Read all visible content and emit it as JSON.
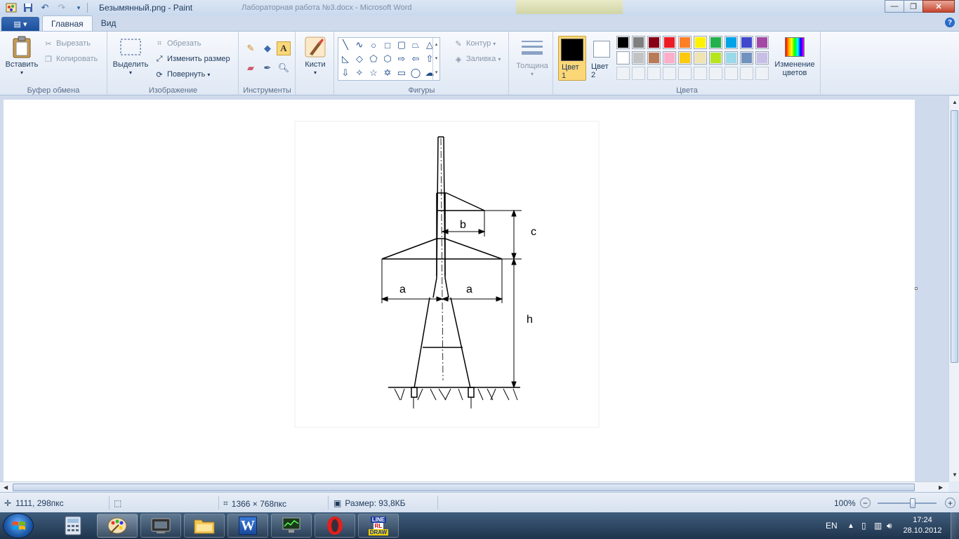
{
  "window": {
    "title": "Безымянный.png - Paint",
    "bg_title": "Лабораторная работа №3.docx - Microsoft Word"
  },
  "tabs": [
    {
      "label": "Главная",
      "active": true
    },
    {
      "label": "Вид",
      "active": false
    }
  ],
  "ribbon": {
    "clipboard": {
      "paste": "Вставить",
      "cut": "Вырезать",
      "copy": "Копировать",
      "label": "Буфер обмена"
    },
    "image": {
      "select": "Выделить",
      "crop": "Обрезать",
      "resize": "Изменить размер",
      "rotate": "Повернуть",
      "label": "Изображение"
    },
    "tools": {
      "label": "Инструменты",
      "active_tool": "text-tool"
    },
    "brushes": {
      "label": "Кисти"
    },
    "shapes": {
      "outline": "Контур",
      "fill": "Заливка",
      "label": "Фигуры"
    },
    "thickness": {
      "label": "Толщина"
    },
    "colors": {
      "color1": "Цвет 1",
      "color2": "Цвет 2",
      "edit": "Изменение цветов",
      "label": "Цвета",
      "color1_value": "#000000",
      "color2_value": "#ffffff",
      "palette_row1": [
        "#000000",
        "#7f7f7f",
        "#880015",
        "#ed1c24",
        "#ff7f27",
        "#fff200",
        "#22b14c",
        "#00a2e8",
        "#3f48cc",
        "#a349a4"
      ],
      "palette_row2": [
        "#ffffff",
        "#c3c3c3",
        "#b97a57",
        "#ffaec9",
        "#ffc90e",
        "#efe4b0",
        "#b5e61d",
        "#99d9ea",
        "#7092be",
        "#c8bfe7"
      ],
      "palette_row3": [
        "",
        "",
        "",
        "",
        "",
        "",
        "",
        "",
        "",
        ""
      ]
    }
  },
  "drawing": {
    "labels": {
      "a_left": "a",
      "a_right": "a",
      "b": "b",
      "c": "c",
      "h": "h"
    }
  },
  "status": {
    "cursor": "1111, 298пкс",
    "dimensions": "1366 × 768пкс",
    "size": "Размер: 93,8КБ",
    "zoom": "100%",
    "zoom_fraction": 0.6
  },
  "taskbar": {
    "apps": [
      "calculator",
      "paint",
      "video-app",
      "explorer",
      "word",
      "monitor",
      "opera",
      "linedraw"
    ],
    "linedraw_label_top": "LINE",
    "linedraw_label_mid": "RL",
    "linedraw_label_bottom": "DRAW",
    "word_letter": "W",
    "lang": "EN",
    "time": "17:24",
    "date": "28.10.2012"
  }
}
